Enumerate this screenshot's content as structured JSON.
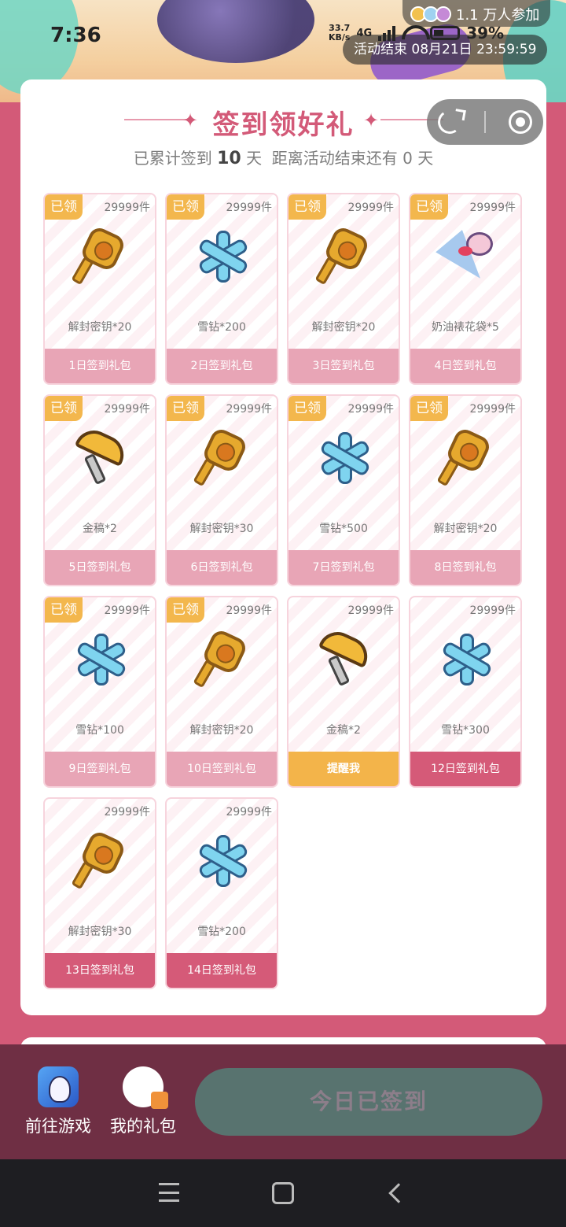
{
  "status_bar": {
    "time": "7:36",
    "net_speed_value": "33.7",
    "net_speed_unit": "KB/s",
    "network": "4G",
    "battery": "39%"
  },
  "banner": {
    "participants": "1.1 万人参加",
    "deadline": "活动结束 08月21日 23:59:59"
  },
  "signin": {
    "title": "签到领好礼",
    "subtitle_prefix": "已累计签到",
    "days_signed": "10",
    "subtitle_mid": "天  距离活动结束还有",
    "days_left": "0",
    "subtitle_suffix": "天"
  },
  "claimed_label": "已领",
  "rewards": [
    {
      "stock": "29999件",
      "item": "解封密钥*20",
      "footer": "1日签到礼包",
      "claimed": true,
      "icon": "key-icon"
    },
    {
      "stock": "29999件",
      "item": "雪钻*200",
      "footer": "2日签到礼包",
      "claimed": true,
      "icon": "snow-diamond-icon"
    },
    {
      "stock": "29999件",
      "item": "解封密钥*20",
      "footer": "3日签到礼包",
      "claimed": true,
      "icon": "key-icon"
    },
    {
      "stock": "29999件",
      "item": "奶油裱花袋*5",
      "footer": "4日签到礼包",
      "claimed": true,
      "icon": "piping-bag-icon"
    },
    {
      "stock": "29999件",
      "item": "金稿*2",
      "footer": "5日签到礼包",
      "claimed": true,
      "icon": "pickaxe-icon"
    },
    {
      "stock": "29999件",
      "item": "解封密钥*30",
      "footer": "6日签到礼包",
      "claimed": true,
      "icon": "key-icon"
    },
    {
      "stock": "29999件",
      "item": "雪钻*500",
      "footer": "7日签到礼包",
      "claimed": true,
      "icon": "snow-diamond-icon"
    },
    {
      "stock": "29999件",
      "item": "解封密钥*20",
      "footer": "8日签到礼包",
      "claimed": true,
      "icon": "key-icon"
    },
    {
      "stock": "29999件",
      "item": "雪钻*100",
      "footer": "9日签到礼包",
      "claimed": true,
      "icon": "snow-diamond-icon"
    },
    {
      "stock": "29999件",
      "item": "解封密钥*20",
      "footer": "10日签到礼包",
      "claimed": true,
      "icon": "key-icon"
    },
    {
      "stock": "29999件",
      "item": "金稿*2",
      "footer": "提醒我",
      "claimed": false,
      "icon": "pickaxe-icon"
    },
    {
      "stock": "29999件",
      "item": "雪钻*300",
      "footer": "12日签到礼包",
      "claimed": false,
      "icon": "snow-diamond-icon"
    },
    {
      "stock": "29999件",
      "item": "解封密钥*30",
      "footer": "13日签到礼包",
      "claimed": false,
      "icon": "key-icon"
    },
    {
      "stock": "29999件",
      "item": "雪钻*200",
      "footer": "14日签到礼包",
      "claimed": false,
      "icon": "snow-diamond-icon"
    }
  ],
  "bottom_bar": {
    "game_label": "前往游戏",
    "gift_label": "我的礼包",
    "signed_label": "今日已签到"
  },
  "colors": {
    "page_bg": "#d35a78",
    "accent": "#d35a78",
    "claimed_tag": "#f3b74d",
    "footer_claimed": "#e8a5b6",
    "footer_active": "#d55a78",
    "remind": "#f3b44a",
    "bottom_bar": "#6f2f44",
    "signed_button": "#58736f"
  }
}
